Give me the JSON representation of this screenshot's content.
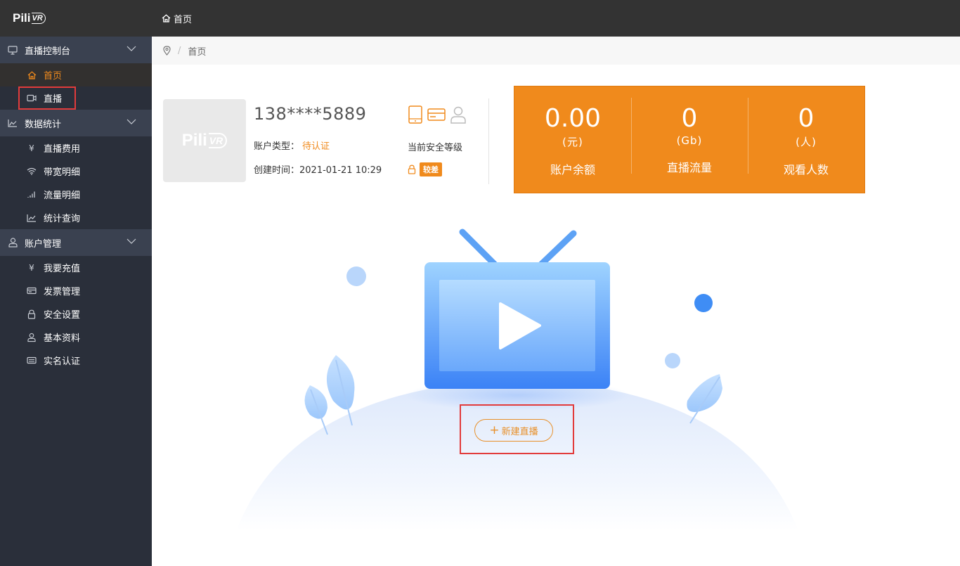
{
  "app": {
    "logo_text": "Pili",
    "logo_suffix": "VR"
  },
  "header": {
    "tab_label": "首页"
  },
  "sidebar": {
    "groups": [
      {
        "label": "直播控制台",
        "icon": "monitor-icon",
        "items": [
          {
            "label": "首页",
            "icon": "home-icon",
            "active": true
          },
          {
            "label": "直播",
            "icon": "video-camera-icon",
            "highlighted": true
          }
        ]
      },
      {
        "label": "数据统计",
        "icon": "area-chart-icon",
        "items": [
          {
            "label": "直播费用",
            "icon": "yen-icon"
          },
          {
            "label": "带宽明细",
            "icon": "wifi-icon"
          },
          {
            "label": "流量明细",
            "icon": "signal-bars-icon"
          },
          {
            "label": "统计查询",
            "icon": "line-chart-icon"
          }
        ]
      },
      {
        "label": "账户管理",
        "icon": "user-icon",
        "items": [
          {
            "label": "我要充值",
            "icon": "yen-icon"
          },
          {
            "label": "发票管理",
            "icon": "card-icon"
          },
          {
            "label": "安全设置",
            "icon": "lock-icon"
          },
          {
            "label": "基本资料",
            "icon": "user-icon"
          },
          {
            "label": "实名认证",
            "icon": "id-card-icon"
          }
        ]
      }
    ]
  },
  "breadcrumb": {
    "current": "首页"
  },
  "profile": {
    "phone": "138****5889",
    "account_type_label": "账户类型：",
    "account_type_value": "待认证",
    "created_label": "创建时间：",
    "created_value": "2021-01-21 10:29",
    "security_label": "当前安全等级",
    "security_level": "较差"
  },
  "stats": [
    {
      "value": "0.00",
      "unit": "(元)",
      "label": "账户余额"
    },
    {
      "value": "0",
      "unit": "(Gb)",
      "label": "直播流量"
    },
    {
      "value": "0",
      "unit": "(人)",
      "label": "观看人数"
    }
  ],
  "actions": {
    "new_live_plus": "+",
    "new_live_label": "新建直播"
  },
  "colors": {
    "accent": "#f08a1c",
    "sidebar_bg": "#2a2f3a",
    "topbar_bg": "#333333",
    "highlight_box": "#e23b3b"
  }
}
